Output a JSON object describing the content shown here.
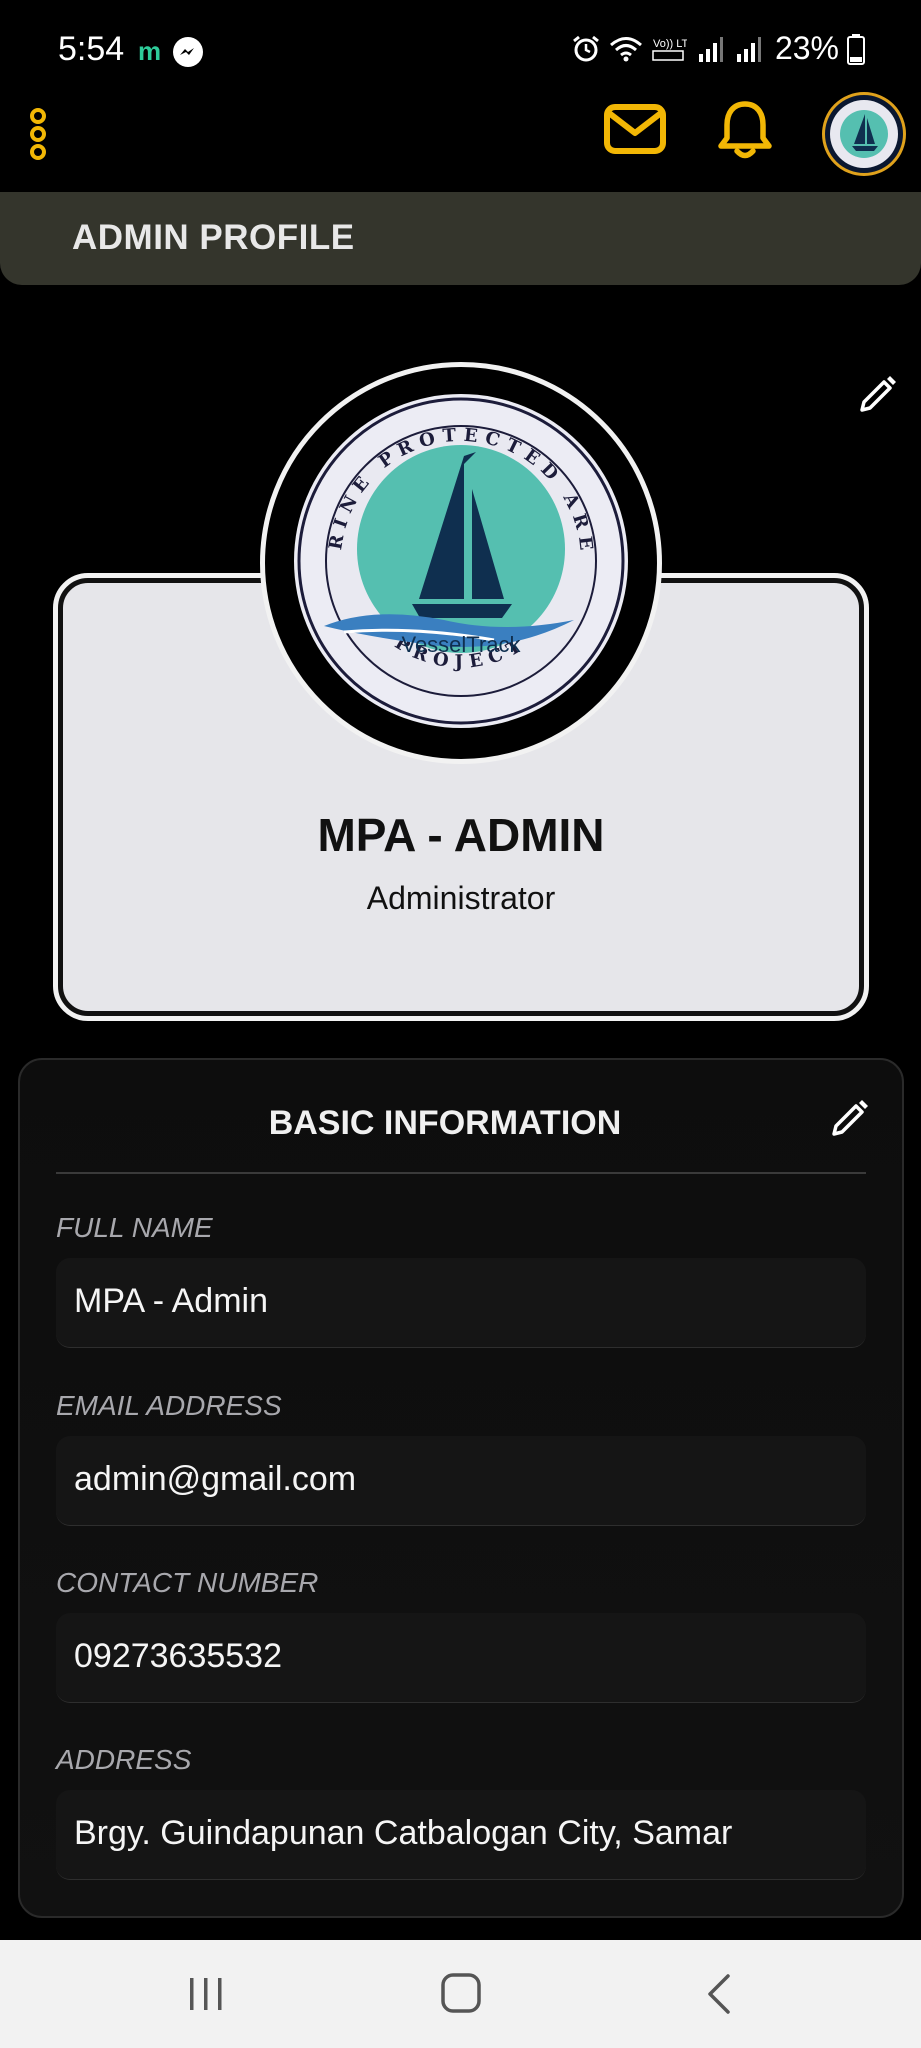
{
  "status_bar": {
    "time": "5:54",
    "app_indicator": "m",
    "network_label": "Vo)) LTE1",
    "battery_percent": "23%"
  },
  "app_bar": {
    "icons": [
      "menu-dots-icon",
      "mail-icon",
      "bell-icon",
      "avatar"
    ]
  },
  "page": {
    "title": "ADMIN PROFILE"
  },
  "profile": {
    "name": "MPA - ADMIN",
    "role": "Administrator",
    "logo_text": {
      "top": "MARINE PROTECTED AREAS",
      "bottom": "PROJECT",
      "brand": "VesselTrack"
    }
  },
  "basic_info": {
    "title": "BASIC INFORMATION",
    "fields": [
      {
        "label": "FULL NAME",
        "value": "MPA - Admin"
      },
      {
        "label": "EMAIL ADDRESS",
        "value": "admin@gmail.com"
      },
      {
        "label": "CONTACT NUMBER",
        "value": "09273635532"
      },
      {
        "label": "ADDRESS",
        "value": "Brgy. Guindapunan Catbalogan City, Samar"
      }
    ]
  },
  "colors": {
    "accent": "#f2b705",
    "title_bar": "#34352c",
    "logo_teal": "#55bfb0",
    "logo_navy": "#0f2f4f"
  }
}
